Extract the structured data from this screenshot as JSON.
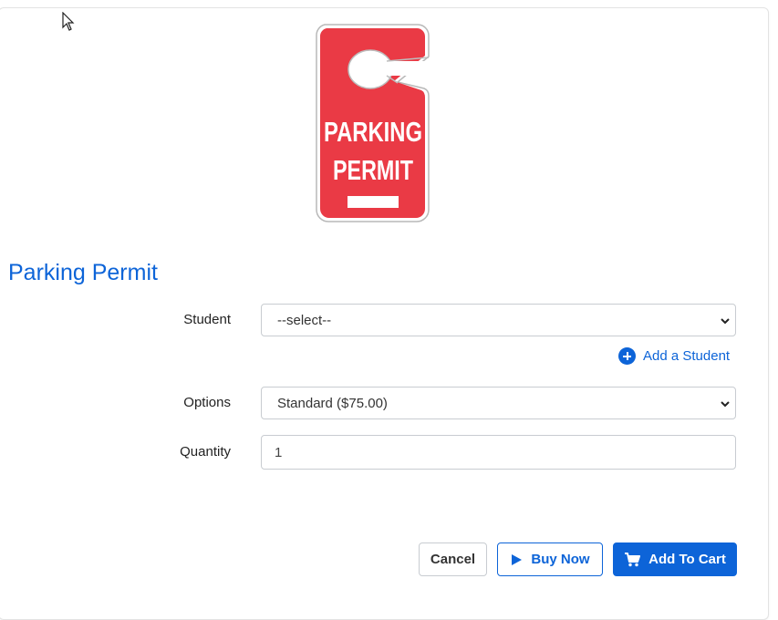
{
  "product": {
    "image_text": [
      "PARKING",
      "PERMIT"
    ],
    "title": "Parking Permit"
  },
  "form": {
    "student": {
      "label": "Student",
      "value": "--select--"
    },
    "add_student_label": "Add a Student",
    "options": {
      "label": "Options",
      "value": "Standard ($75.00)"
    },
    "quantity": {
      "label": "Quantity",
      "value": "1"
    }
  },
  "actions": {
    "cancel_label": "Cancel",
    "buy_now_label": "Buy Now",
    "add_to_cart_label": "Add To Cart"
  },
  "icons": {
    "add": "plus-circle-icon",
    "buy": "play-icon",
    "cart": "cart-icon",
    "dropdown": "chevron-down-icon"
  },
  "colors": {
    "accent": "#0d64d8",
    "permit_red": "#ea3a45"
  }
}
